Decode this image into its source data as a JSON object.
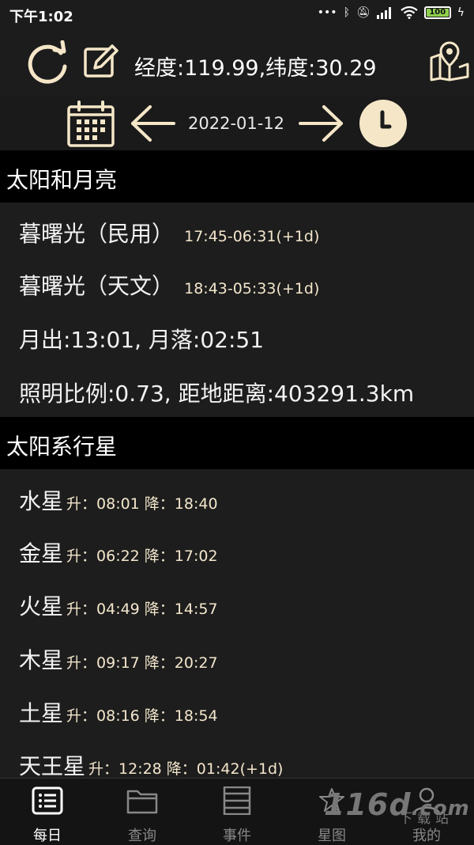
{
  "status": {
    "time": "下午1:02",
    "battery": "100"
  },
  "toolbar": {
    "coords": "经度:119.99,纬度:30.29"
  },
  "datebar": {
    "date": "2022-01-12"
  },
  "sun_moon": {
    "header": "太阳和月亮",
    "civil_label": "暮曙光（民用）",
    "civil_value": "17:45-06:31(+1d)",
    "astro_label": "暮曙光（天文）",
    "astro_value": "18:43-05:33(+1d)",
    "moon_rise_set": "月出:13:01, 月落:02:51",
    "illumination": "照明比例:0.73, 距地距离:403291.3km"
  },
  "planets": {
    "header": "太阳系行星",
    "items": [
      {
        "name": "水星",
        "times": "升：08:01 降：18:40"
      },
      {
        "name": "金星",
        "times": "升：06:22 降：17:02"
      },
      {
        "name": "火星",
        "times": "升：04:49 降：14:57"
      },
      {
        "name": "木星",
        "times": "升：09:17 降：20:27"
      },
      {
        "name": "土星",
        "times": "升：08:16 降：18:54"
      },
      {
        "name": "天王星",
        "times": "升：12:28 降：01:42(+1d)"
      }
    ]
  },
  "nav": {
    "items": [
      {
        "label": "每日",
        "icon": "daily-list-icon"
      },
      {
        "label": "查询",
        "icon": "folder-icon"
      },
      {
        "label": "事件",
        "icon": "events-icon"
      },
      {
        "label": "星图",
        "icon": "star-map-icon"
      },
      {
        "label": "我的",
        "icon": "user-icon"
      }
    ]
  },
  "watermark": {
    "main": "116d",
    "suffix": ".com",
    "sub": "下载站"
  },
  "colors": {
    "accent": "#f5e6c8",
    "background": "#1d1d1d",
    "section": "#000000"
  }
}
